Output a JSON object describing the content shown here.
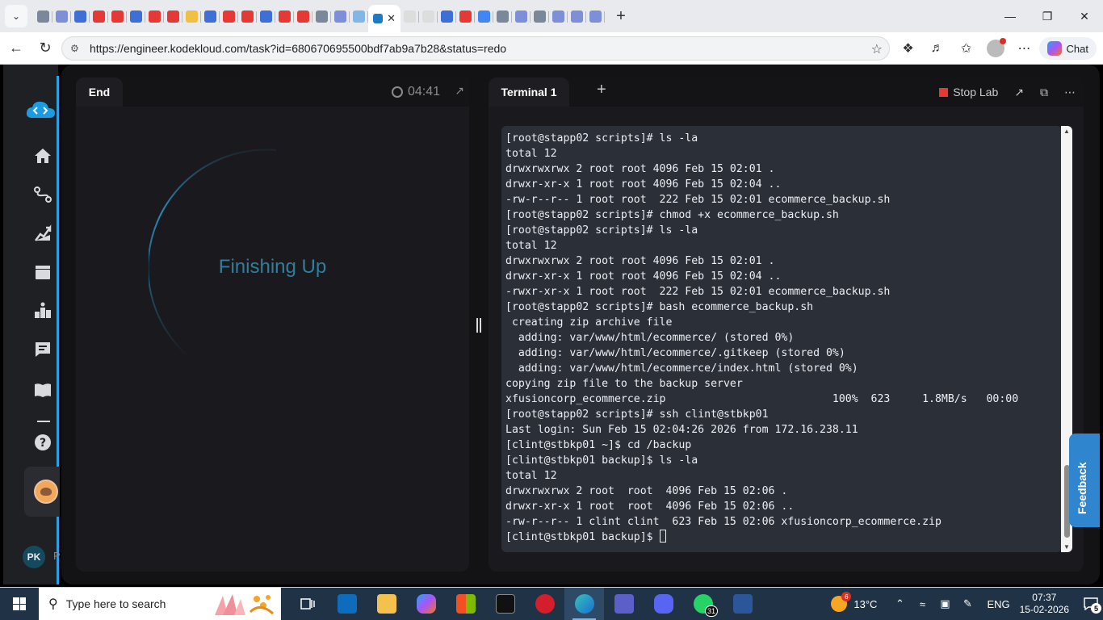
{
  "browser": {
    "tab_favicons": [
      {
        "icon": "gallery-icon",
        "color": "#7a8899"
      },
      {
        "icon": "butterfly-icon",
        "color": "#7d8fd6"
      },
      {
        "icon": "search-icon",
        "color": "#3d6fd6"
      },
      {
        "icon": "youtube-icon",
        "color": "#e53935"
      },
      {
        "icon": "youtube-icon",
        "color": "#e53935"
      },
      {
        "icon": "search-icon",
        "color": "#3d6fd6"
      },
      {
        "icon": "youtube-icon",
        "color": "#e53935"
      },
      {
        "icon": "youtube-icon",
        "color": "#e53935"
      },
      {
        "icon": "bulb-icon",
        "color": "#f0c040"
      },
      {
        "icon": "search-icon",
        "color": "#3d6fd6"
      },
      {
        "icon": "youtube-icon",
        "color": "#e53935"
      },
      {
        "icon": "youtube-icon",
        "color": "#e53935"
      },
      {
        "icon": "search-icon",
        "color": "#3d6fd6"
      },
      {
        "icon": "youtube-icon",
        "color": "#e53935"
      },
      {
        "icon": "youtube-icon",
        "color": "#e53935"
      },
      {
        "icon": "gallery-icon",
        "color": "#7a8899"
      },
      {
        "icon": "butterfly-icon",
        "color": "#7d8fd6"
      },
      {
        "icon": "cloud-icon",
        "color": "#7fb8e8"
      },
      {
        "icon": "kodekloud-icon",
        "color": "#1f7ac4",
        "active": true
      },
      {
        "icon": "doc-icon",
        "color": "#dddddd"
      },
      {
        "icon": "doc-icon",
        "color": "#dddddd"
      },
      {
        "icon": "search-icon",
        "color": "#3d6fd6"
      },
      {
        "icon": "youtube-icon",
        "color": "#e53935"
      },
      {
        "icon": "google-icon",
        "color": "#4285f4"
      },
      {
        "icon": "gallery-icon",
        "color": "#7a8899"
      },
      {
        "icon": "butterfly-icon",
        "color": "#7d8fd6"
      },
      {
        "icon": "gallery-icon",
        "color": "#7a8899"
      },
      {
        "icon": "butterfly-icon",
        "color": "#7d8fd6"
      },
      {
        "icon": "butterfly-icon",
        "color": "#7d8fd6"
      },
      {
        "icon": "butterfly-icon",
        "color": "#7d8fd6"
      }
    ],
    "active_tab_letter": "K",
    "url": "https://engineer.kodekloud.com/task?id=680670695500bdf7ab9a7b28&status=redo",
    "chat_label": "Chat"
  },
  "left_panel": {
    "tab_label": "End",
    "timer": "04:41",
    "status_text": "Finishing Up"
  },
  "right_panel": {
    "tab_label": "Terminal 1",
    "stop_label": "Stop Lab",
    "lines": [
      "[root@stapp02 scripts]# ls -la",
      "total 12",
      "drwxrwxrwx 2 root root 4096 Feb 15 02:01 .",
      "drwxr-xr-x 1 root root 4096 Feb 15 02:04 ..",
      "-rw-r--r-- 1 root root  222 Feb 15 02:01 ecommerce_backup.sh",
      "[root@stapp02 scripts]# chmod +x ecommerce_backup.sh",
      "[root@stapp02 scripts]# ls -la",
      "total 12",
      "drwxrwxrwx 2 root root 4096 Feb 15 02:01 .",
      "drwxr-xr-x 1 root root 4096 Feb 15 02:04 ..",
      "-rwxr-xr-x 1 root root  222 Feb 15 02:01 ecommerce_backup.sh",
      "[root@stapp02 scripts]# bash ecommerce_backup.sh",
      " creating zip archive file",
      "  adding: var/www/html/ecommerce/ (stored 0%)",
      "  adding: var/www/html/ecommerce/.gitkeep (stored 0%)",
      "  adding: var/www/html/ecommerce/index.html (stored 0%)",
      "copying zip file to the backup server",
      "xfusioncorp_ecommerce.zip                          100%  623     1.8MB/s   00:00",
      "[root@stapp02 scripts]# ssh clint@stbkp01",
      "Last login: Sun Feb 15 02:04:26 2026 from 172.16.238.11",
      "[clint@stbkp01 ~]$ cd /backup",
      "[clint@stbkp01 backup]$ ls -la",
      "total 12",
      "drwxrwxrwx 2 root  root  4096 Feb 15 02:06 .",
      "drwxr-xr-x 1 root  root  4096 Feb 15 02:06 ..",
      "-rw-r--r-- 1 clint clint  623 Feb 15 02:06 xfusioncorp_ecommerce.zip"
    ],
    "prompt": "[clint@stbkp01 backup]$ "
  },
  "sidebar": {
    "user_initials": "PK",
    "user_name_initial": "P"
  },
  "feedback_label": "Feedback",
  "taskbar": {
    "search_placeholder": "Type here to search",
    "whatsapp_badge": "31",
    "weather_badge": "6",
    "temperature": "13°C",
    "language": "ENG",
    "time": "07:37",
    "date": "15-02-2026",
    "notification_count": "5"
  },
  "colors": {
    "accent": "#2aa0e6",
    "finishing_text": "#2f7e9c",
    "stop_red": "#e53935",
    "feedback_blue": "#2f86cf"
  }
}
